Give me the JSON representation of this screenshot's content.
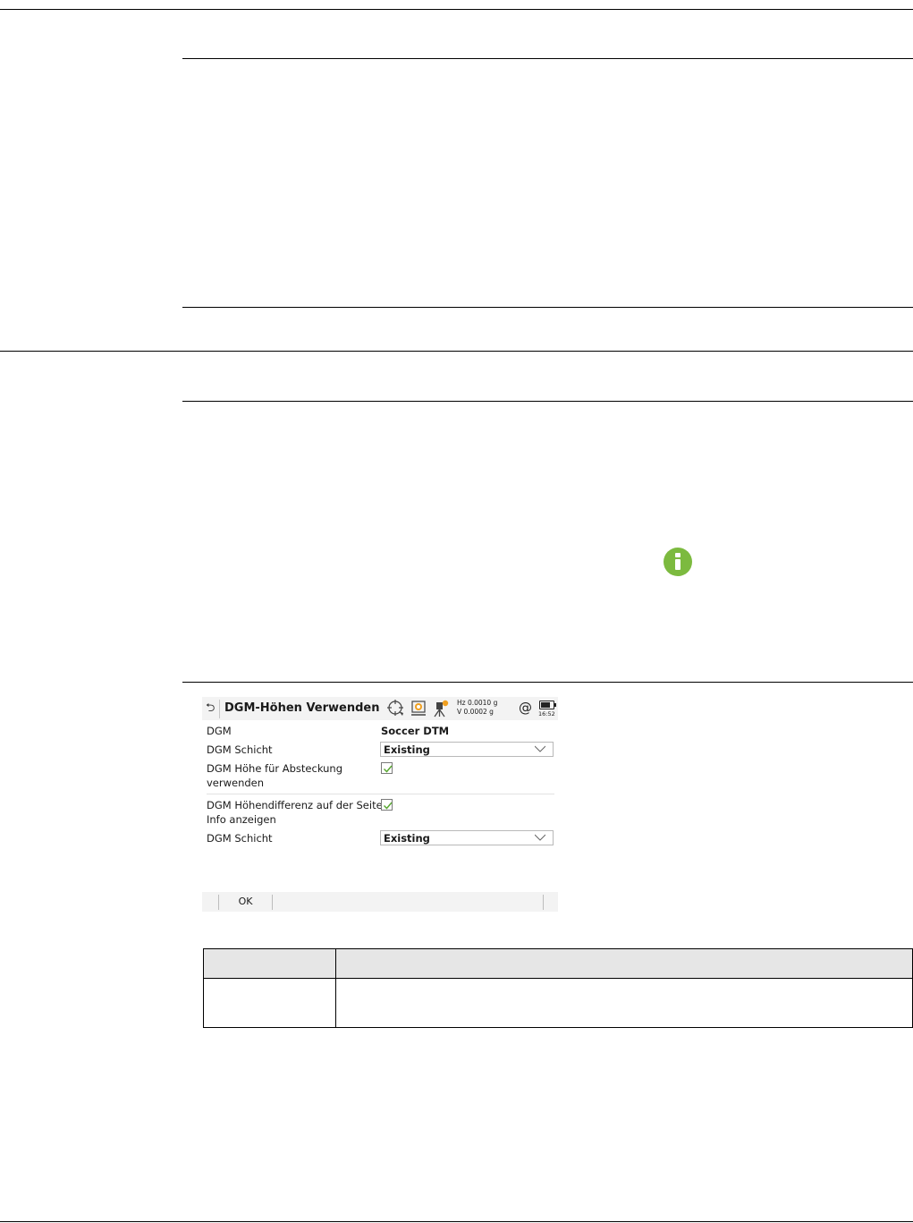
{
  "screen": {
    "title": "DGM-Höhen Verwenden",
    "status": {
      "hz": "Hz 0.0010 g",
      "v": "V  0.0002 g",
      "time": "16:52",
      "at_symbol": "@"
    },
    "rows": [
      {
        "label": "DGM",
        "value": "Soccer DTM"
      },
      {
        "label": "DGM Schicht",
        "value": "Existing"
      },
      {
        "label_line1": "DGM Höhe für Absteckung",
        "label_line2": "verwenden",
        "checked": true
      },
      {
        "label_line1": "DGM Höhendifferenz auf der Seite",
        "label_line2": "Info anzeigen",
        "checked": true
      },
      {
        "label": "DGM Schicht",
        "value": "Existing"
      }
    ],
    "softkeys": {
      "ok": "OK"
    }
  },
  "icons": {
    "back": "back-arrow-icon",
    "info": "info-icon",
    "colors": {
      "info": "#7cba3f",
      "check": "#5aa832",
      "warning": "#f0a020"
    }
  }
}
